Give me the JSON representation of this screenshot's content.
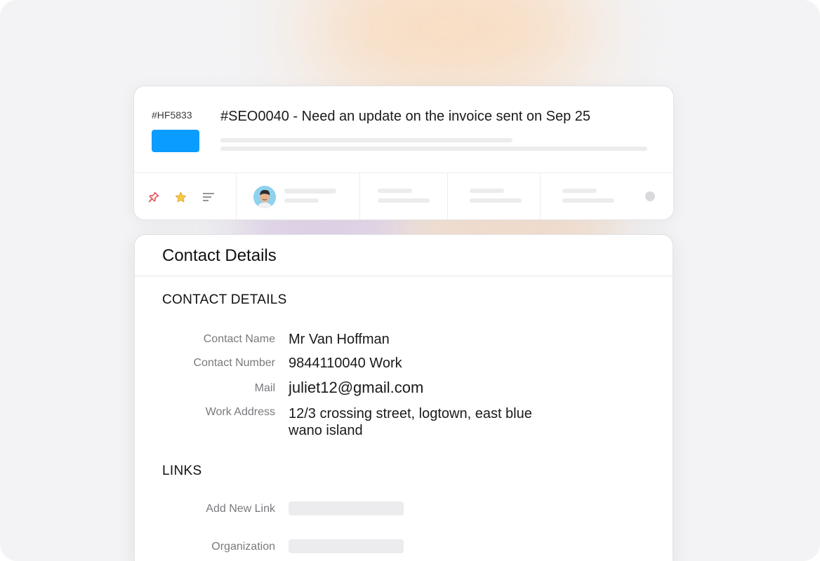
{
  "ticket": {
    "id": "#HF5833",
    "status_color": "#0b9cff",
    "title": "#SEO0040 - Need an update on the invoice sent on Sep 25",
    "icons": [
      "pin-icon",
      "star-icon",
      "menu-lines-icon"
    ]
  },
  "contact_panel": {
    "title": "Contact Details",
    "section_contact": "CONTACT DETAILS",
    "fields": [
      {
        "label": "Contact Name",
        "value": "Mr Van Hoffman"
      },
      {
        "label": "Contact Number",
        "value": "9844110040 Work"
      },
      {
        "label": "Mail",
        "value": "juliet12@gmail.com"
      },
      {
        "label": "Work Address",
        "value_line1": "12/3 crossing street, logtown, east blue",
        "value_line2": "wano island"
      }
    ],
    "section_links": "LINKS",
    "link_fields": [
      {
        "label": "Add New Link"
      },
      {
        "label": "Organization"
      }
    ]
  }
}
